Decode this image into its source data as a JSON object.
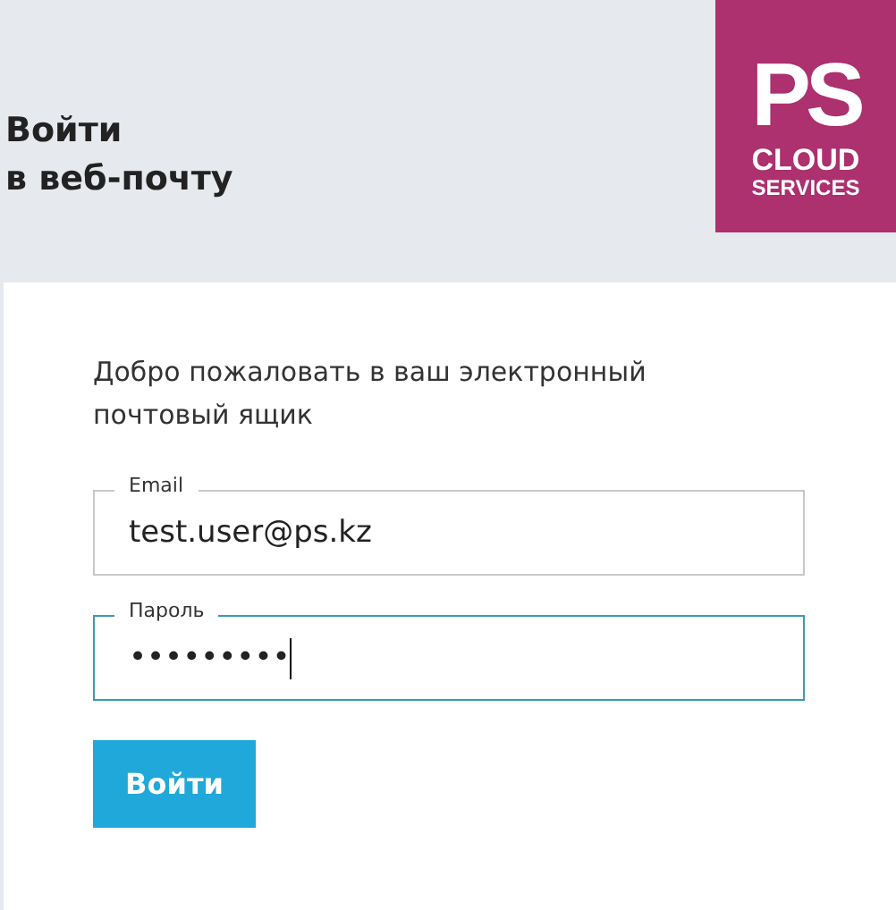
{
  "header": {
    "title": "Войти\nв веб-почту",
    "logo": {
      "mark": "PS",
      "line_1": "CLOUD",
      "line_2": "SERVICES"
    }
  },
  "form": {
    "intro": "Добро пожаловать в ваш электронный почтовый ящик",
    "fields": [
      {
        "label": "Email",
        "value": "test.user@ps.kz",
        "focused": false
      },
      {
        "label": "Пароль",
        "value": "•••••••••",
        "focused": true
      }
    ],
    "submit": "Войти"
  }
}
